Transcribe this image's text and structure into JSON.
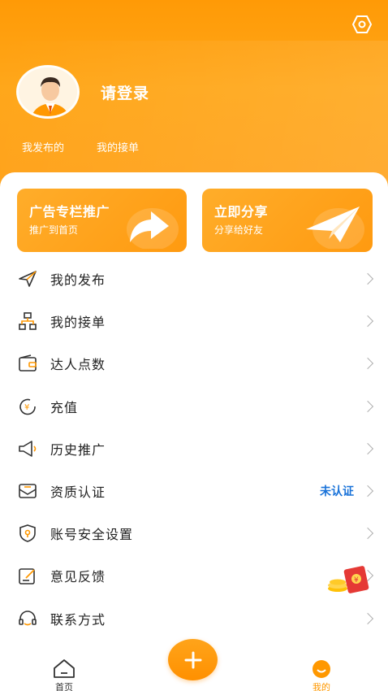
{
  "header": {
    "login_label": "请登录",
    "tabs": [
      "我发布的",
      "我的接单"
    ]
  },
  "promo": {
    "ad": {
      "title": "广告专栏推广",
      "subtitle": "推广到首页"
    },
    "share": {
      "title": "立即分享",
      "subtitle": "分享给好友"
    }
  },
  "menu": [
    {
      "label": "我的发布",
      "icon": "send-icon"
    },
    {
      "label": "我的接单",
      "icon": "org-chart-icon"
    },
    {
      "label": "达人点数",
      "icon": "wallet-icon"
    },
    {
      "label": "充值",
      "icon": "recharge-icon"
    },
    {
      "label": "历史推广",
      "icon": "megaphone-icon"
    },
    {
      "label": "资质认证",
      "icon": "envelope-icon",
      "status": "未认证"
    },
    {
      "label": "账号安全设置",
      "icon": "shield-icon"
    },
    {
      "label": "意见反馈",
      "icon": "feedback-icon"
    },
    {
      "label": "联系方式",
      "icon": "headset-icon"
    }
  ],
  "bottom_nav": {
    "home": "首页",
    "mine": "我的"
  },
  "colors": {
    "accent": "#ff9a06",
    "status_blue": "#1a73d9"
  }
}
